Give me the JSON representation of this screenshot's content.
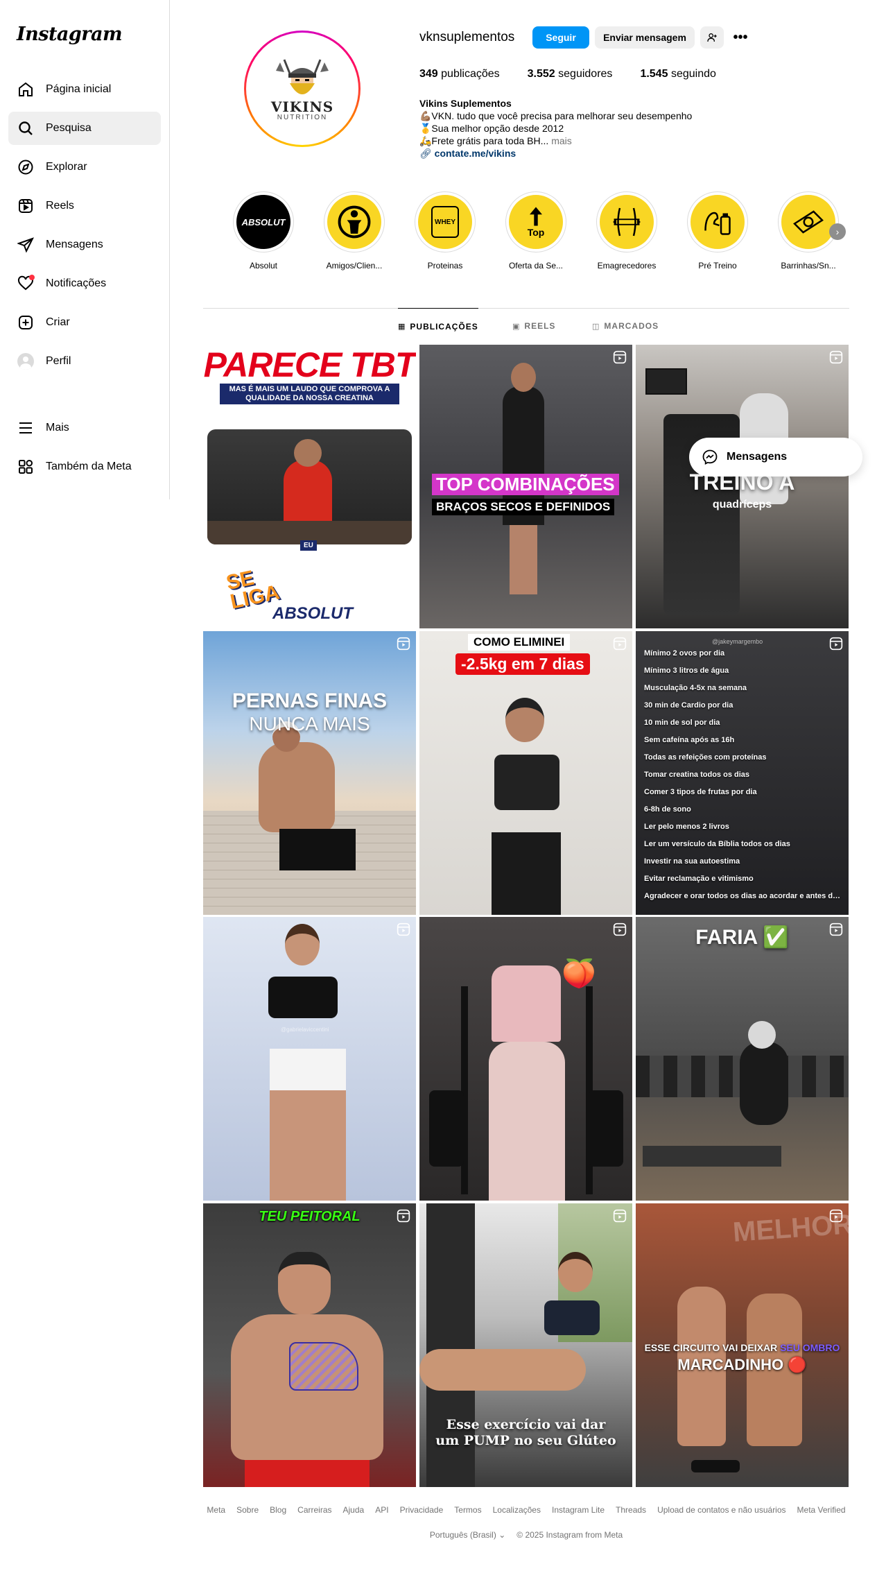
{
  "sidebar": {
    "logo": "Instagram",
    "items": [
      {
        "label": "Página inicial",
        "icon": "home-icon"
      },
      {
        "label": "Pesquisa",
        "icon": "search-icon"
      },
      {
        "label": "Explorar",
        "icon": "compass-icon"
      },
      {
        "label": "Reels",
        "icon": "reels-icon"
      },
      {
        "label": "Mensagens",
        "icon": "messages-icon"
      },
      {
        "label": "Notificações",
        "icon": "heart-icon"
      },
      {
        "label": "Criar",
        "icon": "plus-square-icon"
      },
      {
        "label": "Perfil",
        "icon": "profile-avatar"
      },
      {
        "label": "Mais",
        "icon": "menu-icon"
      },
      {
        "label": "Também da Meta",
        "icon": "meta-apps-icon"
      }
    ]
  },
  "profile": {
    "username": "vknsuplementos",
    "follow_label": "Seguir",
    "message_label": "Enviar mensagem",
    "more_label": "•••",
    "logo_word": "VIKINS",
    "logo_sub": "NUTRITION",
    "stats": {
      "posts_value": "349",
      "posts_label": "publicações",
      "followers_value": "3.552",
      "followers_label": "seguidores",
      "following_value": "1.545",
      "following_label": "seguindo"
    },
    "bio": {
      "name": "Vikins Suplementos",
      "line1": "💪🏽VKN. tudo que você precisa para melhorar seu desempenho",
      "line2": "🥇Sua melhor opção desde 2012",
      "line3": "🛵Frete grátis para toda BH...",
      "more": "mais",
      "link": "contate.me/vikins"
    }
  },
  "highlights": [
    {
      "label": "Absolut",
      "inner_text": "ABSOLUT"
    },
    {
      "label": "Amigos/Clien...",
      "inner_text": ""
    },
    {
      "label": "Proteinas",
      "inner_text": "WHEY"
    },
    {
      "label": "Oferta da Se...",
      "inner_text": "Top"
    },
    {
      "label": "Emagrecedores",
      "inner_text": ""
    },
    {
      "label": "Pré Treino",
      "inner_text": ""
    },
    {
      "label": "Barrinhas/Sn...",
      "inner_text": ""
    }
  ],
  "tabs": [
    {
      "label": "PUBLICAÇÕES"
    },
    {
      "label": "REELS"
    },
    {
      "label": "MARCADOS"
    }
  ],
  "posts": {
    "p1": {
      "title": "PARECE TBT",
      "subtitle": "MAS É MAIS UM LAUDO QUE COMPROVA A QUALIDADE DA NOSSA CREATINA",
      "tag": "EU",
      "brand": "ABSOLUT",
      "sticker": "SE LIGA"
    },
    "p2": {
      "title": "TOP COMBINAÇÕES",
      "subtitle": "BRAÇOS SECOS E DEFINIDOS"
    },
    "p3": {
      "title": "TREINO A",
      "subtitle": "quadríceps"
    },
    "p4": {
      "title": "PERNAS FINAS",
      "subtitle": "NUNCA MAIS"
    },
    "p5": {
      "title": "COMO ELIMINEI",
      "subtitle": "-2.5kg em 7 dias"
    },
    "p6": {
      "handle": "@jakeymargembo",
      "items": [
        "Mínimo 2 ovos por dia",
        "Mínimo 3 litros de água",
        "Musculação 4-5x na semana",
        "30 min de Cardio por dia",
        "10 min de sol por dia",
        "Sem cafeína após as 16h",
        "Todas as refeições com proteínas",
        "Tomar creatina todos os dias",
        "Comer 3 tipos de frutas por dia",
        "6-8h de sono",
        "Ler pelo menos 2 livros",
        "Ler um versículo da Bíblia todos os dias",
        "Investir na sua autoestima",
        "Evitar reclamação e vitimismo",
        "Agradecer e orar todos os dias ao acordar e antes de dormir"
      ]
    },
    "p7": {
      "handle": "@gabrielaviccentini"
    },
    "p8": {
      "emoji": "🍑"
    },
    "p9": {
      "title": "FARIA ✅"
    },
    "p10": {
      "title": "TEU PEITORAL"
    },
    "p11": {
      "title": "Esse exercício vai dar um PUMP no seu Glúteo"
    },
    "p12": {
      "line1_a": "ESSE CIRCUITO VAI DEIXAR ",
      "line1_b": "SEU OMBRO",
      "line2": "MARCADINHO 🔴",
      "wall": "MELHOR"
    }
  },
  "floating_messages": {
    "label": "Mensagens"
  },
  "footer": {
    "links": [
      "Meta",
      "Sobre",
      "Blog",
      "Carreiras",
      "Ajuda",
      "API",
      "Privacidade",
      "Termos",
      "Localizações",
      "Instagram Lite",
      "Threads",
      "Upload de contatos e não usuários",
      "Meta Verified"
    ],
    "language": "Português (Brasil)",
    "copyright": "© 2025 Instagram from Meta"
  },
  "colors": {
    "accent": "#0095f6",
    "highlight_yellow": "#f9d624",
    "notif_red": "#ff3040"
  }
}
